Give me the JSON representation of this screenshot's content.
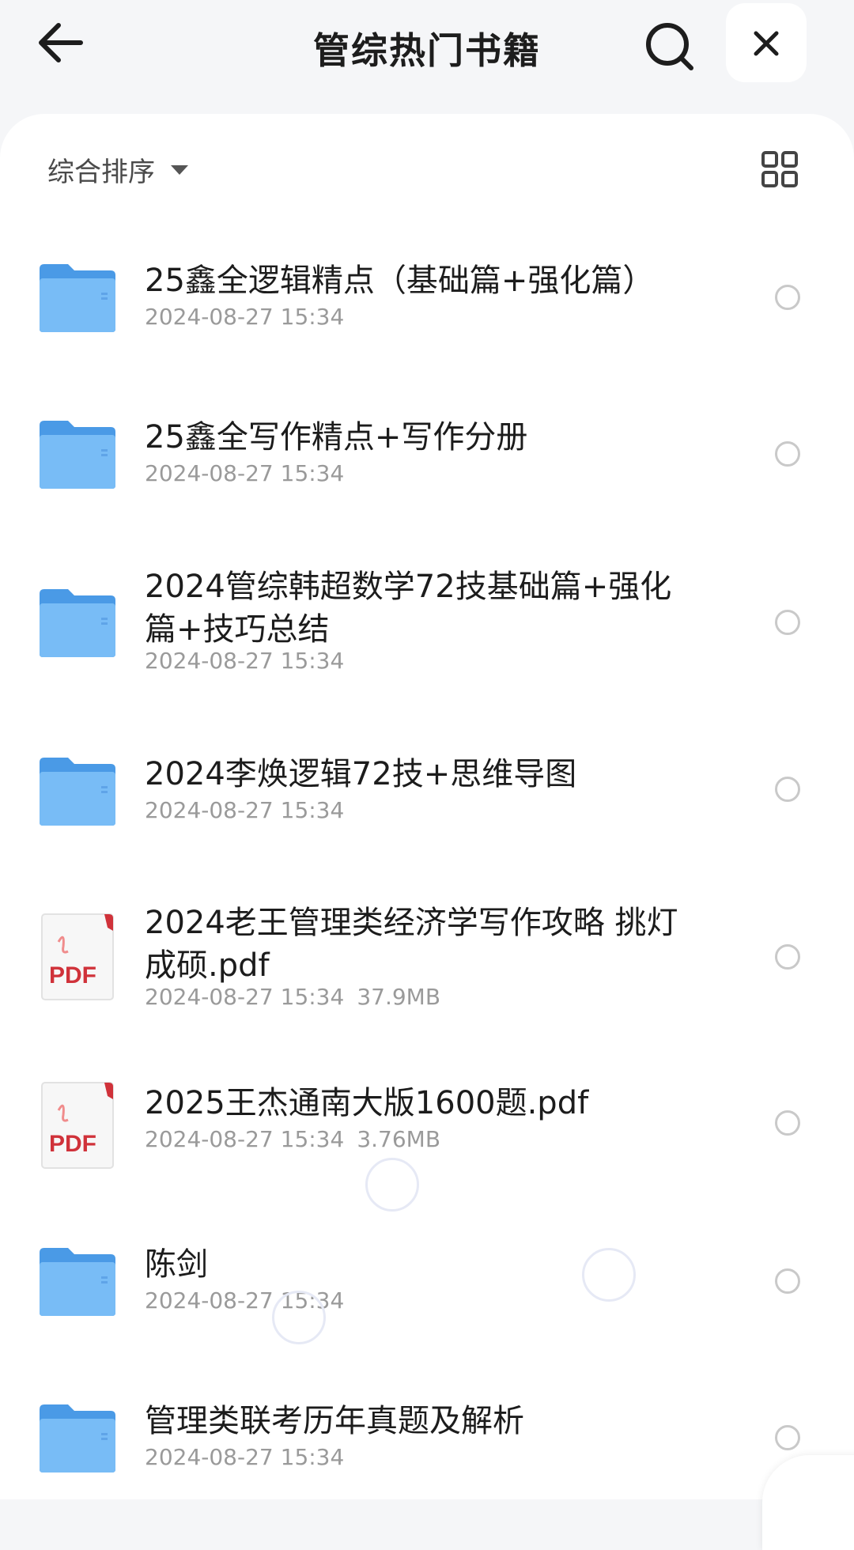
{
  "header": {
    "title": "管综热门书籍",
    "back_icon": "arrow-left-icon",
    "search_icon": "search-icon",
    "close_icon": "close-icon"
  },
  "toolbar": {
    "sort_label": "综合排序",
    "view_toggle_icon": "grid-view-icon"
  },
  "files": [
    {
      "type": "folder",
      "name": "25鑫全逻辑精点（基础篇+强化篇）",
      "date": "2024-08-27 15:34",
      "size": ""
    },
    {
      "type": "folder",
      "name": "25鑫全写作精点+写作分册",
      "date": "2024-08-27 15:34",
      "size": ""
    },
    {
      "type": "folder",
      "name": "2024管综韩超数学72技基础篇+强化篇+技巧总结",
      "date": "2024-08-27 15:34",
      "size": ""
    },
    {
      "type": "folder",
      "name": "2024李焕逻辑72技+思维导图",
      "date": "2024-08-27 15:34",
      "size": ""
    },
    {
      "type": "pdf",
      "name": "2024老王管理类经济学写作攻略 挑灯成硕.pdf",
      "date": "2024-08-27 15:34",
      "size": "37.9MB"
    },
    {
      "type": "pdf",
      "name": "2025王杰通南大版1600题.pdf",
      "date": "2024-08-27 15:34",
      "size": "3.76MB"
    },
    {
      "type": "folder",
      "name": "陈剑",
      "date": "2024-08-27 15:34",
      "size": ""
    },
    {
      "type": "folder",
      "name": "管理类联考历年真题及解析",
      "date": "2024-08-27 15:34",
      "size": ""
    }
  ],
  "pdf_badge": "PDF",
  "colors": {
    "folder": "#5aa9f0",
    "pdf_red": "#d0323a",
    "page_bg": "#f5f6f8"
  }
}
